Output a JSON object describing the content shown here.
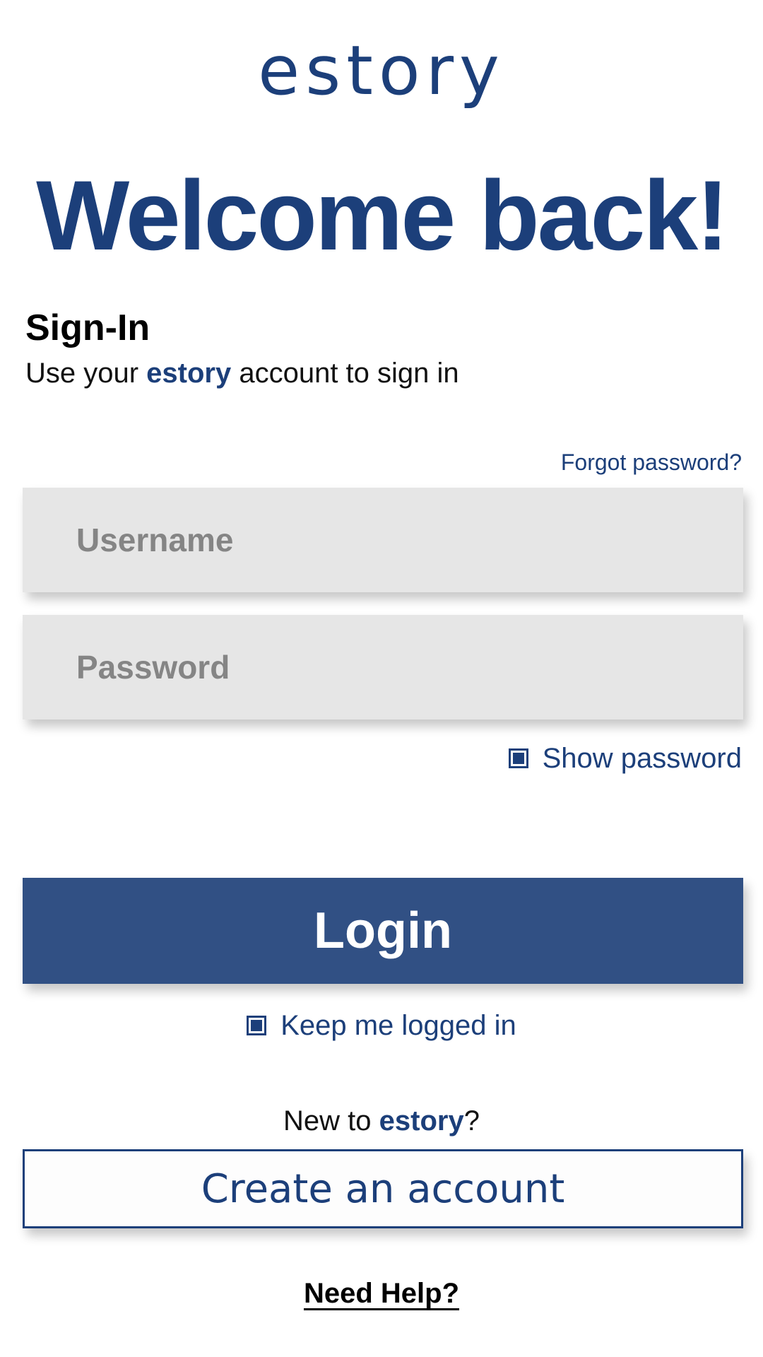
{
  "header": {
    "logo_text": "estory",
    "welcome": "Welcome back!"
  },
  "signin": {
    "title": "Sign-In",
    "subtitle_prefix": "Use your ",
    "subtitle_brand": "estory",
    "subtitle_suffix": " account to sign in",
    "forgot_password": "Forgot password?"
  },
  "form": {
    "username_placeholder": "Username",
    "password_placeholder": "Password",
    "show_password": "Show password",
    "login_label": "Login",
    "keep_logged_in": "Keep me logged in"
  },
  "signup": {
    "prompt_prefix": "New to ",
    "prompt_brand": "estory",
    "prompt_suffix": "?",
    "create_account": "Create an account"
  },
  "footer": {
    "need_help": "Need Help?"
  },
  "colors": {
    "brand": "#1c3f7a",
    "button": "#315084",
    "field": "#e6e6e6"
  }
}
